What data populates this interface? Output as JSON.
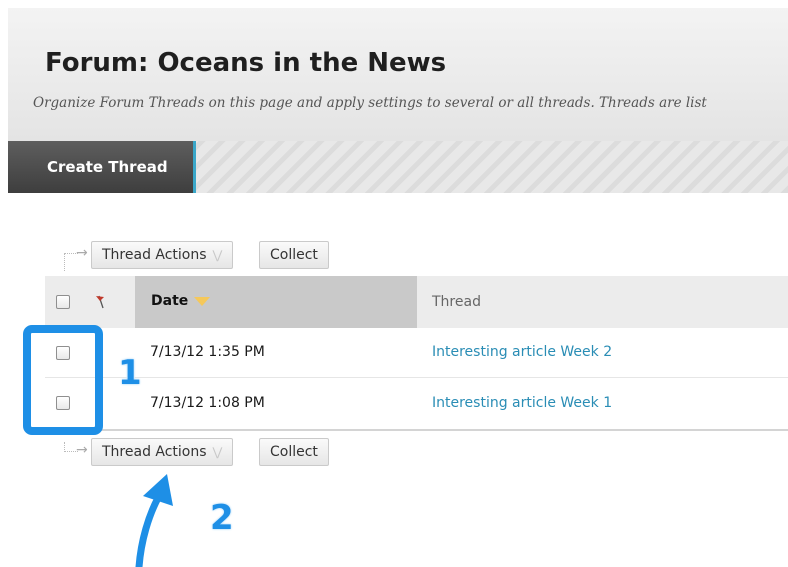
{
  "header": {
    "title": "Forum: Oceans in the News",
    "subtitle": "Organize Forum Threads on this page and apply settings to several or all threads. Threads are list"
  },
  "action_bar": {
    "create_thread_label": "Create Thread"
  },
  "toolbar_top": {
    "thread_actions_label": "Thread Actions",
    "collect_label": "Collect"
  },
  "toolbar_bottom": {
    "thread_actions_label": "Thread Actions",
    "collect_label": "Collect"
  },
  "table": {
    "columns": {
      "date": "Date",
      "thread": "Thread"
    },
    "sorted_column": "date",
    "rows": [
      {
        "date": "7/13/12 1:35 PM",
        "thread": "Interesting article Week 2",
        "checked": false
      },
      {
        "date": "7/13/12 1:08 PM",
        "thread": "Interesting article Week 1",
        "checked": false
      }
    ]
  },
  "annotations": {
    "callout_1": "1",
    "callout_2": "2",
    "accent_color": "#1e8fe6"
  },
  "icons": {
    "flag": "flag-icon",
    "sort": "sort-desc-icon",
    "dropdown": "chevron-down-icon",
    "toolbar_arrow": "corner-arrow-icon"
  },
  "colors": {
    "link": "#2a8db5",
    "create_thread_bg": "#4a4a4a",
    "create_thread_border": "#3aa7c9"
  }
}
